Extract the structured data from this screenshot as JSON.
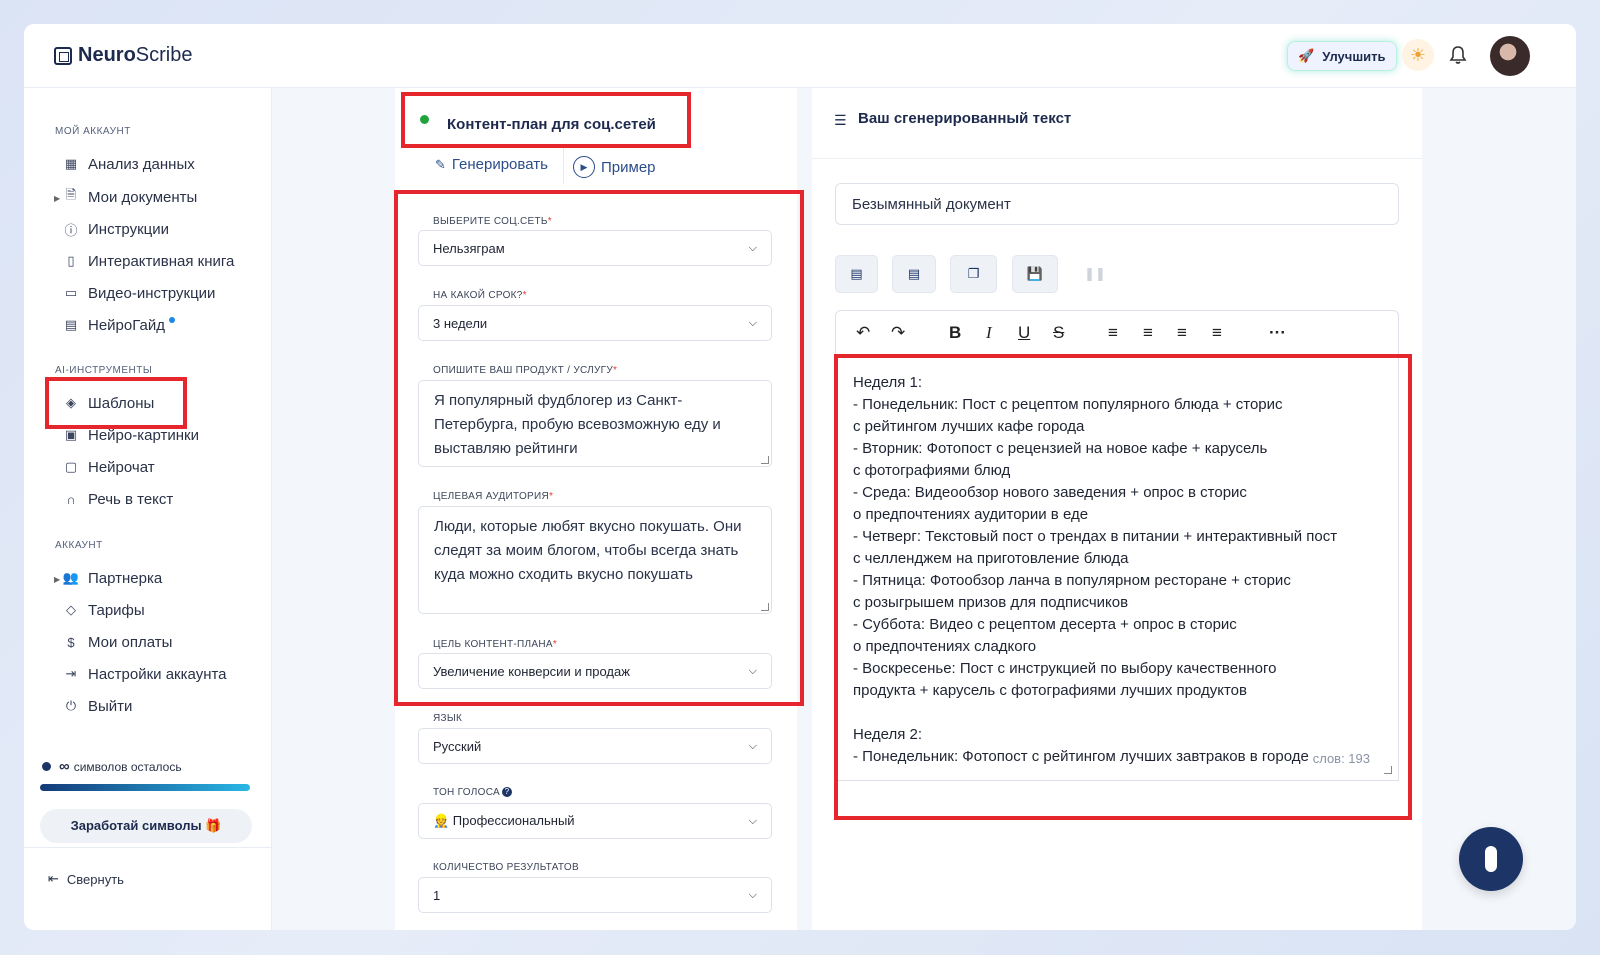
{
  "app": {
    "logo_bold": "Neuro",
    "logo_light": "Scribe"
  },
  "header": {
    "upgrade_label": "Улучшить"
  },
  "sidebar": {
    "sections": [
      {
        "title": "МОЙ АККАУНТ"
      },
      {
        "title": "AI-ИНСТРУМЕНТЫ"
      },
      {
        "title": "АККАУНТ"
      }
    ],
    "items": [
      {
        "label": "Анализ данных"
      },
      {
        "label": "Мои документы"
      },
      {
        "label": "Инструкции"
      },
      {
        "label": "Интерактивная книга"
      },
      {
        "label": "Видео-инструкции"
      },
      {
        "label": "НейроГайд"
      },
      {
        "label": "Шаблоны"
      },
      {
        "label": "Нейро-картинки"
      },
      {
        "label": "Нейрочат"
      },
      {
        "label": "Речь в текст"
      },
      {
        "label": "Партнерка"
      },
      {
        "label": "Тарифы"
      },
      {
        "label": "Мои оплаты"
      },
      {
        "label": "Настройки аккаунта"
      },
      {
        "label": "Выйти"
      }
    ],
    "quota_symbol": "∞",
    "quota_text": "символов осталось",
    "earn_label": "Заработай символы 🎁",
    "collapse_label": "Свернуть"
  },
  "form": {
    "title": "Контент-план для соц.сетей",
    "tab_generate": "Генерировать",
    "tab_example": "Пример",
    "fields": {
      "network_label": "ВЫБЕРИТЕ СОЦ.СЕТЬ",
      "network_value": "Нельзяграм",
      "term_label": "НА КАКОЙ СРОК?",
      "term_value": "3 недели",
      "product_label": "ОПИШИТЕ ВАШ ПРОДУКТ / УСЛУГУ",
      "product_value": "Я популярный фудблогер из Санкт-Петербурга, пробую всевозможную еду и выставляю рейтинги",
      "audience_label": "ЦЕЛЕВАЯ АУДИТОРИЯ",
      "audience_value": "Люди, которые любят вкусно покушать. Они следят за моим блогом, чтобы всегда знать куда можно сходить вкусно покушать",
      "goal_label": "ЦЕЛЬ КОНТЕНТ-ПЛАНА",
      "goal_value": "Увеличение конверсии и продаж",
      "lang_label": "ЯЗЫК",
      "lang_value": "Русский",
      "tone_label": "ТОН ГОЛОСА",
      "tone_value": "👷 Профессиональный",
      "count_label": "КОЛИЧЕСТВО РЕЗУЛЬТАТОВ",
      "count_value": "1"
    }
  },
  "output": {
    "title": "Ваш сгенерированный текст",
    "doc_name": "Безымянный документ",
    "lines": [
      "Неделя 1:",
      "- Понедельник: Пост с рецептом популярного блюда + сторис",
      "с рейтингом лучших кафе города",
      "- Вторник: Фотопост с рецензией на новое кафе + карусель",
      "с фотографиями блюд",
      "- Среда: Видеообзор нового заведения + опрос в сторис",
      "о предпочтениях аудитории в еде",
      "- Четверг: Текстовый пост о трендах в питании + интерактивный пост",
      "с челленджем на приготовление блюда",
      "- Пятница: Фотообзор ланча в популярном ресторане + сторис",
      "с розыгрышем призов для подписчиков",
      "- Суббота: Видео с рецептом десерта + опрос в сторис",
      "о предпочтениях сладкого",
      "- Воскресенье: Пост с инструкцией по выбору качественного",
      "продукта + карусель с фотографиями лучших продуктов",
      "",
      "Неделя 2:",
      "- Понедельник: Фотопост с рейтингом лучших завтраков в городе"
    ],
    "word_count": "слов: 193"
  }
}
